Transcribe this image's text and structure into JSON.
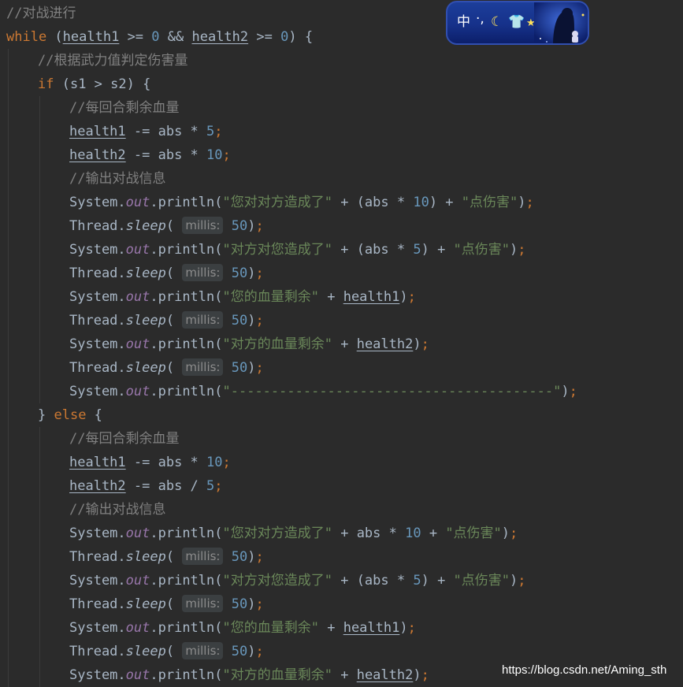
{
  "code": {
    "lines": [
      {
        "tokens": [
          {
            "t": "//对战进行",
            "c": "cm"
          }
        ]
      },
      {
        "tokens": [
          {
            "t": "while",
            "c": "kw"
          },
          {
            "t": " ("
          },
          {
            "t": "health1",
            "c": "ul"
          },
          {
            "t": " >= "
          },
          {
            "t": "0",
            "c": "num"
          },
          {
            "t": " && "
          },
          {
            "t": "health2",
            "c": "ul"
          },
          {
            "t": " >= "
          },
          {
            "t": "0",
            "c": "num"
          },
          {
            "t": ") {"
          }
        ]
      },
      {
        "tokens": [
          {
            "t": "//根据武力值判定伤害量",
            "c": "cm"
          }
        ]
      },
      {
        "tokens": [
          {
            "t": "if",
            "c": "kw"
          },
          {
            "t": " (s1 > s2) {"
          }
        ]
      },
      {
        "tokens": [
          {
            "t": "//每回合剩余血量",
            "c": "cm"
          }
        ]
      },
      {
        "tokens": [
          {
            "t": "health1",
            "c": "ul"
          },
          {
            "t": " -= abs * "
          },
          {
            "t": "5",
            "c": "num"
          },
          {
            "t": ";",
            "c": "semi"
          }
        ]
      },
      {
        "tokens": [
          {
            "t": "health2",
            "c": "ul"
          },
          {
            "t": " -= abs * "
          },
          {
            "t": "10",
            "c": "num"
          },
          {
            "t": ";",
            "c": "semi"
          }
        ]
      },
      {
        "tokens": [
          {
            "t": "//输出对战信息",
            "c": "cm"
          }
        ]
      },
      {
        "tokens": [
          {
            "t": "System."
          },
          {
            "t": "out",
            "c": "fld"
          },
          {
            "t": ".println("
          },
          {
            "t": "\"您对对方造成了\"",
            "c": "str"
          },
          {
            "t": " + (abs * "
          },
          {
            "t": "10",
            "c": "num"
          },
          {
            "t": ") + "
          },
          {
            "t": "\"点伤害\"",
            "c": "str"
          },
          {
            "t": ")"
          },
          {
            "t": ";",
            "c": "semi"
          }
        ]
      },
      {
        "tokens": [
          {
            "t": "Thread."
          },
          {
            "t": "sleep",
            "c": "sfn"
          },
          {
            "t": "( "
          },
          {
            "t": "millis:",
            "c": "hint"
          },
          {
            "t": " 50",
            "c": "num"
          },
          {
            "t": ")"
          },
          {
            "t": ";",
            "c": "semi"
          }
        ]
      },
      {
        "tokens": [
          {
            "t": "System."
          },
          {
            "t": "out",
            "c": "fld"
          },
          {
            "t": ".println("
          },
          {
            "t": "\"对方对您造成了\"",
            "c": "str"
          },
          {
            "t": " + (abs * "
          },
          {
            "t": "5",
            "c": "num"
          },
          {
            "t": ") + "
          },
          {
            "t": "\"点伤害\"",
            "c": "str"
          },
          {
            "t": ")"
          },
          {
            "t": ";",
            "c": "semi"
          }
        ]
      },
      {
        "tokens": [
          {
            "t": "Thread."
          },
          {
            "t": "sleep",
            "c": "sfn"
          },
          {
            "t": "( "
          },
          {
            "t": "millis:",
            "c": "hint"
          },
          {
            "t": " 50",
            "c": "num"
          },
          {
            "t": ")"
          },
          {
            "t": ";",
            "c": "semi"
          }
        ]
      },
      {
        "tokens": [
          {
            "t": "System."
          },
          {
            "t": "out",
            "c": "fld"
          },
          {
            "t": ".println("
          },
          {
            "t": "\"您的血量剩余\"",
            "c": "str"
          },
          {
            "t": " + "
          },
          {
            "t": "health1",
            "c": "ul"
          },
          {
            "t": ")"
          },
          {
            "t": ";",
            "c": "semi"
          }
        ]
      },
      {
        "tokens": [
          {
            "t": "Thread."
          },
          {
            "t": "sleep",
            "c": "sfn"
          },
          {
            "t": "( "
          },
          {
            "t": "millis:",
            "c": "hint"
          },
          {
            "t": " 50",
            "c": "num"
          },
          {
            "t": ")"
          },
          {
            "t": ";",
            "c": "semi"
          }
        ]
      },
      {
        "tokens": [
          {
            "t": "System."
          },
          {
            "t": "out",
            "c": "fld"
          },
          {
            "t": ".println("
          },
          {
            "t": "\"对方的血量剩余\"",
            "c": "str"
          },
          {
            "t": " + "
          },
          {
            "t": "health2",
            "c": "ul"
          },
          {
            "t": ")"
          },
          {
            "t": ";",
            "c": "semi"
          }
        ]
      },
      {
        "tokens": [
          {
            "t": "Thread."
          },
          {
            "t": "sleep",
            "c": "sfn"
          },
          {
            "t": "( "
          },
          {
            "t": "millis:",
            "c": "hint"
          },
          {
            "t": " 50",
            "c": "num"
          },
          {
            "t": ")"
          },
          {
            "t": ";",
            "c": "semi"
          }
        ]
      },
      {
        "tokens": [
          {
            "t": "System."
          },
          {
            "t": "out",
            "c": "fld"
          },
          {
            "t": ".println("
          },
          {
            "t": "\"----------------------------------------\"",
            "c": "str"
          },
          {
            "t": ")"
          },
          {
            "t": ";",
            "c": "semi"
          }
        ]
      },
      {
        "tokens": [
          {
            "t": "} "
          },
          {
            "t": "else",
            "c": "kw"
          },
          {
            "t": " {"
          }
        ]
      },
      {
        "tokens": [
          {
            "t": "//每回合剩余血量",
            "c": "cm"
          }
        ]
      },
      {
        "tokens": [
          {
            "t": "health1",
            "c": "ul"
          },
          {
            "t": " -= abs * "
          },
          {
            "t": "10",
            "c": "num"
          },
          {
            "t": ";",
            "c": "semi"
          }
        ]
      },
      {
        "tokens": [
          {
            "t": "health2",
            "c": "ul"
          },
          {
            "t": " -= abs / "
          },
          {
            "t": "5",
            "c": "num"
          },
          {
            "t": ";",
            "c": "semi"
          }
        ]
      },
      {
        "tokens": [
          {
            "t": "//输出对战信息",
            "c": "cm"
          }
        ]
      },
      {
        "tokens": [
          {
            "t": "System."
          },
          {
            "t": "out",
            "c": "fld"
          },
          {
            "t": ".println("
          },
          {
            "t": "\"您对对方造成了\"",
            "c": "str"
          },
          {
            "t": " + abs * "
          },
          {
            "t": "10",
            "c": "num"
          },
          {
            "t": " + "
          },
          {
            "t": "\"点伤害\"",
            "c": "str"
          },
          {
            "t": ")"
          },
          {
            "t": ";",
            "c": "semi"
          }
        ]
      },
      {
        "tokens": [
          {
            "t": "Thread."
          },
          {
            "t": "sleep",
            "c": "sfn"
          },
          {
            "t": "( "
          },
          {
            "t": "millis:",
            "c": "hint"
          },
          {
            "t": " 50",
            "c": "num"
          },
          {
            "t": ")"
          },
          {
            "t": ";",
            "c": "semi"
          }
        ]
      },
      {
        "tokens": [
          {
            "t": "System."
          },
          {
            "t": "out",
            "c": "fld"
          },
          {
            "t": ".println("
          },
          {
            "t": "\"对方对您造成了\"",
            "c": "str"
          },
          {
            "t": " + (abs * "
          },
          {
            "t": "5",
            "c": "num"
          },
          {
            "t": ") + "
          },
          {
            "t": "\"点伤害\"",
            "c": "str"
          },
          {
            "t": ")"
          },
          {
            "t": ";",
            "c": "semi"
          }
        ]
      },
      {
        "tokens": [
          {
            "t": "Thread."
          },
          {
            "t": "sleep",
            "c": "sfn"
          },
          {
            "t": "( "
          },
          {
            "t": "millis:",
            "c": "hint"
          },
          {
            "t": " 50",
            "c": "num"
          },
          {
            "t": ")"
          },
          {
            "t": ";",
            "c": "semi"
          }
        ]
      },
      {
        "tokens": [
          {
            "t": "System."
          },
          {
            "t": "out",
            "c": "fld"
          },
          {
            "t": ".println("
          },
          {
            "t": "\"您的血量剩余\"",
            "c": "str"
          },
          {
            "t": " + "
          },
          {
            "t": "health1",
            "c": "ul"
          },
          {
            "t": ")"
          },
          {
            "t": ";",
            "c": "semi"
          }
        ]
      },
      {
        "tokens": [
          {
            "t": "Thread."
          },
          {
            "t": "sleep",
            "c": "sfn"
          },
          {
            "t": "( "
          },
          {
            "t": "millis:",
            "c": "hint"
          },
          {
            "t": " 50",
            "c": "num"
          },
          {
            "t": ")"
          },
          {
            "t": ";",
            "c": "semi"
          }
        ]
      },
      {
        "tokens": [
          {
            "t": "System."
          },
          {
            "t": "out",
            "c": "fld"
          },
          {
            "t": ".println("
          },
          {
            "t": "\"对方的血量剩余\"",
            "c": "str"
          },
          {
            "t": " + "
          },
          {
            "t": "health2",
            "c": "ul"
          },
          {
            "t": ")"
          },
          {
            "t": ";",
            "c": "semi"
          }
        ]
      }
    ]
  },
  "ime_toolbar": {
    "mode_label": "中",
    "punct_label": "·,",
    "moon_icon": "crescent-moon",
    "skin_icon": "t-shirt",
    "star_icon": "star",
    "colors": {
      "accent": "#16318a"
    }
  },
  "watermark": "https://blog.csdn.net/Aming_sth",
  "colors": {
    "background": "#2b2b2b",
    "keyword": "#cc7832",
    "comment": "#808080",
    "number": "#6897bb",
    "string": "#6a8759",
    "field": "#9876aa",
    "text": "#a9b7c6"
  }
}
